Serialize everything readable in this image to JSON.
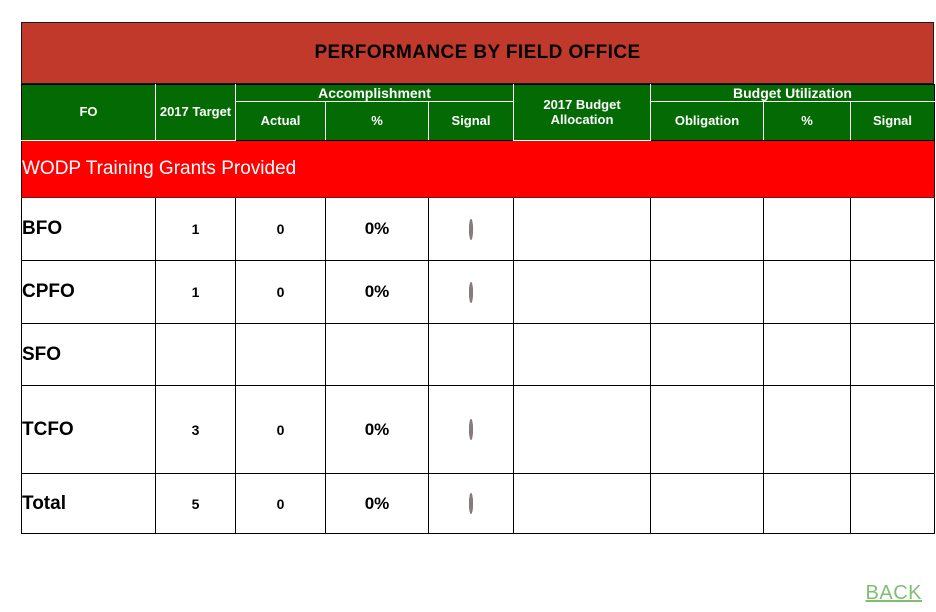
{
  "banner": {
    "title": "PERFORMANCE BY FIELD OFFICE",
    "bg_color": "#C0392B",
    "text_color": "#000000"
  },
  "header": {
    "fo": "FO",
    "target": "2017 Target",
    "accomplishment_group": "Accomplishment",
    "accomplishment_actual": "Actual",
    "accomplishment_pct": "%",
    "accomplishment_signal": "Signal",
    "budget_allocation": "2017 Budget Allocation",
    "budget_utilization_group": "Budget Utilization",
    "obligation": "Obligation",
    "utilization_pct": "%",
    "utilization_signal": "Signal",
    "bg_color": "#046A04",
    "text_color": "#FFFFFF"
  },
  "section": {
    "label": "WODP Training Grants Provided",
    "bg_color": "#FF0000",
    "text_color": "#FFFFFF"
  },
  "rows": [
    {
      "fo": "BFO",
      "target": "1",
      "actual": "0",
      "acc_pct": "0%",
      "acc_signal": "red",
      "allocation": "",
      "obligation": "",
      "util_pct": "",
      "util_signal": ""
    },
    {
      "fo": "CPFO",
      "target": "1",
      "actual": "0",
      "acc_pct": "0%",
      "acc_signal": "red",
      "allocation": "",
      "obligation": "",
      "util_pct": "",
      "util_signal": ""
    },
    {
      "fo": "SFO",
      "target": "",
      "actual": "",
      "acc_pct": "",
      "acc_signal": "",
      "allocation": "",
      "obligation": "",
      "util_pct": "",
      "util_signal": ""
    },
    {
      "fo": "TCFO",
      "target": "3",
      "actual": "0",
      "acc_pct": "0%",
      "acc_signal": "red",
      "allocation": "",
      "obligation": "",
      "util_pct": "",
      "util_signal": ""
    },
    {
      "fo": "Total",
      "target": "5",
      "actual": "0",
      "acc_pct": "0%",
      "acc_signal": "red",
      "allocation": "",
      "obligation": "",
      "util_pct": "",
      "util_signal": ""
    }
  ],
  "footer": {
    "back_label": "BACK",
    "back_color": "#80BF72"
  },
  "signal_colors": {
    "red": "#FF0000"
  }
}
